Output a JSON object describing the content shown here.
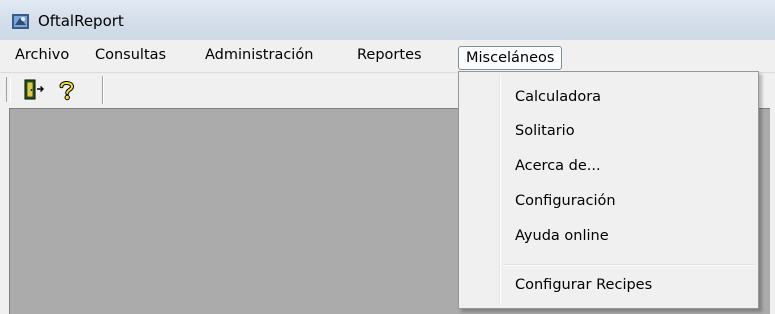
{
  "window": {
    "title": "OftalReport"
  },
  "menubar": {
    "items": [
      "Archivo",
      "Consultas",
      "Administración",
      "Reportes",
      "Misceláneos"
    ],
    "open_item": "Misceláneos"
  },
  "toolbar": {
    "buttons": [
      {
        "icon": "exit-door-icon"
      },
      {
        "icon": "help-icon"
      }
    ]
  },
  "dropdown": {
    "items": [
      "Calculadora",
      "Solitario",
      "Acerca de...",
      "Configuración",
      "Ayuda online"
    ],
    "after_separator": [
      "Configurar Recipes"
    ]
  },
  "colors": {
    "titlebar": "#d6dfeb",
    "menu_background": "#f0f0f0",
    "client_area": "#ababab",
    "open_menu_border": "#838d98"
  }
}
